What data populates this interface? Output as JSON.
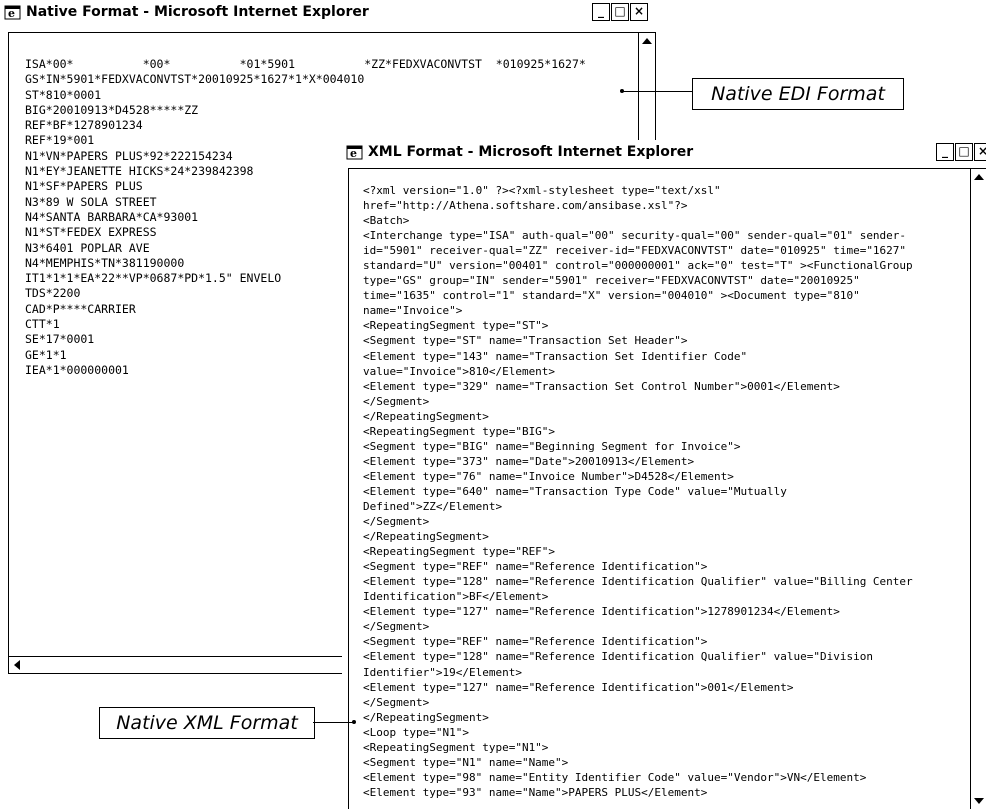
{
  "native_window": {
    "title": "Native Format - Microsoft Internet Explorer",
    "lines": [
      "ISA*00*          *00*          *01*5901          *ZZ*FEDXVACONVTST  *010925*1627*",
      "GS*IN*5901*FEDXVACONVTST*20010925*1627*1*X*004010",
      "ST*810*0001",
      "BIG*20010913*D4528*****ZZ",
      "REF*BF*1278901234",
      "REF*19*001",
      "N1*VN*PAPERS PLUS*92*222154234",
      "N1*EY*JEANETTE HICKS*24*239842398",
      "N1*SF*PAPERS PLUS",
      "N3*89 W SOLA STREET",
      "N4*SANTA BARBARA*CA*93001",
      "N1*ST*FEDEX EXPRESS",
      "N3*6401 POPLAR AVE",
      "N4*MEMPHIS*TN*381190000",
      "IT1*1*1*EA*22**VP*0687*PD*1.5\" ENVELO",
      "TDS*2200",
      "CAD*P****CARRIER",
      "CTT*1",
      "SE*17*0001",
      "GE*1*1",
      "IEA*1*000000001"
    ]
  },
  "xml_window": {
    "title": "XML Format - Microsoft Internet Explorer",
    "lines": [
      "<?xml version=\"1.0\" ?><?xml-stylesheet type=\"text/xsl\"",
      "href=\"http://Athena.softshare.com/ansibase.xsl\"?>",
      "<Batch>",
      "<Interchange type=\"ISA\" auth-qual=\"00\" security-qual=\"00\" sender-qual=\"01\" sender-",
      "id=\"5901\" receiver-qual=\"ZZ\" receiver-id=\"FEDXVACONVTST\" date=\"010925\" time=\"1627\"",
      "standard=\"U\" version=\"00401\" control=\"000000001\" ack=\"0\" test=\"T\" ><FunctionalGroup",
      "type=\"GS\" group=\"IN\" sender=\"5901\" receiver=\"FEDXVACONVTST\" date=\"20010925\"",
      "time=\"1635\" control=\"1\" standard=\"X\" version=\"004010\" ><Document type=\"810\"",
      "name=\"Invoice\">",
      "<RepeatingSegment type=\"ST\">",
      "<Segment type=\"ST\" name=\"Transaction Set Header\">",
      "<Element type=\"143\" name=\"Transaction Set Identifier Code\"",
      "value=\"Invoice\">810</Element>",
      "<Element type=\"329\" name=\"Transaction Set Control Number\">0001</Element>",
      "</Segment>",
      "</RepeatingSegment>",
      "<RepeatingSegment type=\"BIG\">",
      "<Segment type=\"BIG\" name=\"Beginning Segment for Invoice\">",
      "<Element type=\"373\" name=\"Date\">20010913</Element>",
      "<Element type=\"76\" name=\"Invoice Number\">D4528</Element>",
      "<Element type=\"640\" name=\"Transaction Type Code\" value=\"Mutually",
      "Defined\">ZZ</Element>",
      "</Segment>",
      "</RepeatingSegment>",
      "<RepeatingSegment type=\"REF\">",
      "<Segment type=\"REF\" name=\"Reference Identification\">",
      "<Element type=\"128\" name=\"Reference Identification Qualifier\" value=\"Billing Center",
      "Identification\">BF</Element>",
      "<Element type=\"127\" name=\"Reference Identification\">1278901234</Element>",
      "</Segment>",
      "<Segment type=\"REF\" name=\"Reference Identification\">",
      "<Element type=\"128\" name=\"Reference Identification Qualifier\" value=\"Division",
      "Identifier\">19</Element>",
      "<Element type=\"127\" name=\"Reference Identification\">001</Element>",
      "</Segment>",
      "</RepeatingSegment>",
      "<Loop type=\"N1\">",
      "<RepeatingSegment type=\"N1\">",
      "<Segment type=\"N1\" name=\"Name\">",
      "<Element type=\"98\" name=\"Entity Identifier Code\" value=\"Vendor\">VN</Element>",
      "<Element type=\"93\" name=\"Name\">PAPERS PLUS</Element>"
    ]
  },
  "callouts": {
    "native_edi": "Native EDI Format",
    "native_xml": "Native XML Format"
  },
  "window_buttons": {
    "minimize": "_",
    "maximize": "□",
    "close": "×"
  }
}
